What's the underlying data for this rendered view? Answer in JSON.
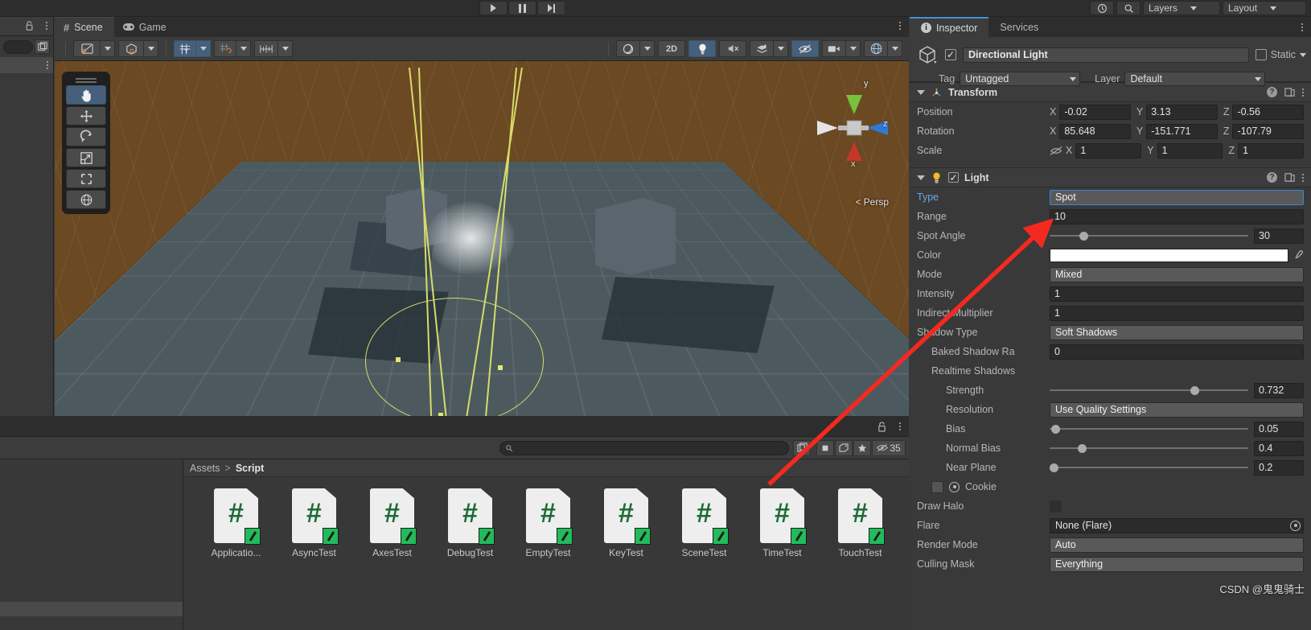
{
  "topbar": {
    "play": "play-icon",
    "pause": "pause-icon",
    "step": "step-icon",
    "collab_label": "collab-icon",
    "cloud_label": "cloud-icon",
    "account_label": "account-icon",
    "layers_label": "Layers",
    "layout_label": "Layout"
  },
  "scene_panel": {
    "tabs": [
      {
        "label": "Scene",
        "icon": "grid-icon",
        "active": true
      },
      {
        "label": "Game",
        "icon": "gamepad-icon",
        "active": false
      }
    ],
    "toolbar": {
      "draw_mode": "shaded-draw-mode-icon",
      "gizmo_mode": "render-mode-icon",
      "lighting_2d3d": "2D",
      "light_toggle": "lightbulb-icon",
      "audio_toggle": "mute-audio-icon",
      "fx_toggle": "effects-icon",
      "hidden_toggle": "hidden-objects-icon",
      "camera_toggle": "scene-camera-icon",
      "gizmos_toggle": "gizmos-icon",
      "grid_visibility": "grid-visibility-icon",
      "grid_snap": "grid-snap-icon",
      "snap_increment": "snap-increment-icon"
    },
    "tools": [
      {
        "name": "hand-tool",
        "active": true
      },
      {
        "name": "move-tool",
        "active": false
      },
      {
        "name": "rotate-tool",
        "active": false
      },
      {
        "name": "scale-tool",
        "active": false
      },
      {
        "name": "rect-tool",
        "active": false
      },
      {
        "name": "transform-tool",
        "active": false
      }
    ],
    "gizmo": {
      "axis_y": "y",
      "axis_x": "x",
      "axis_z": "z",
      "projection": "Persp"
    }
  },
  "project_panel": {
    "search_placeholder": "",
    "search_value": "",
    "breadcrumb": {
      "root": "Assets",
      "separator": ">",
      "current": "Script"
    },
    "assets": [
      {
        "name": "Applicatio...",
        "type": "csharp-script"
      },
      {
        "name": "AsyncTest",
        "type": "csharp-script"
      },
      {
        "name": "AxesTest",
        "type": "csharp-script"
      },
      {
        "name": "DebugTest",
        "type": "csharp-script"
      },
      {
        "name": "EmptyTest",
        "type": "csharp-script"
      },
      {
        "name": "KeyTest",
        "type": "csharp-script"
      },
      {
        "name": "SceneTest",
        "type": "csharp-script"
      },
      {
        "name": "TimeTest",
        "type": "csharp-script"
      },
      {
        "name": "TouchTest",
        "type": "csharp-script"
      }
    ],
    "hidden_count": "35"
  },
  "inspector": {
    "tabs": [
      {
        "label": "Inspector",
        "active": true
      },
      {
        "label": "Services",
        "active": false
      }
    ],
    "object": {
      "enabled": true,
      "name": "Directional Light",
      "static_label": "Static",
      "static_checked": false,
      "tag_label": "Tag",
      "tag_value": "Untagged",
      "layer_label": "Layer",
      "layer_value": "Default"
    },
    "transform": {
      "title": "Transform",
      "position_label": "Position",
      "rotation_label": "Rotation",
      "scale_label": "Scale",
      "axis_x": "X",
      "axis_y": "Y",
      "axis_z": "Z",
      "position": {
        "x": "-0.02",
        "y": "3.13",
        "z": "-0.56"
      },
      "rotation": {
        "x": "85.648",
        "y": "-151.771",
        "z": "-107.79"
      },
      "scale": {
        "x": "1",
        "y": "1",
        "z": "1"
      }
    },
    "light": {
      "title": "Light",
      "enabled": true,
      "type_label": "Type",
      "type_value": "Spot",
      "range_label": "Range",
      "range_value": "10",
      "spot_angle_label": "Spot Angle",
      "spot_angle_value": "30",
      "spot_angle_pct": 17,
      "color_label": "Color",
      "color_value": "#ffffff",
      "mode_label": "Mode",
      "mode_value": "Mixed",
      "intensity_label": "Intensity",
      "intensity_value": "1",
      "indirect_label": "Indirect Multiplier",
      "indirect_value": "1",
      "shadow_type_label": "Shadow Type",
      "shadow_type_value": "Soft Shadows",
      "baked_shadow_label": "Baked Shadow Ra",
      "baked_shadow_value": "0",
      "realtime_shadows_label": "Realtime Shadows",
      "strength_label": "Strength",
      "strength_value": "0.732",
      "strength_pct": 73,
      "resolution_label": "Resolution",
      "resolution_value": "Use Quality Settings",
      "bias_label": "Bias",
      "bias_value": "0.05",
      "bias_pct": 3,
      "normal_bias_label": "Normal Bias",
      "normal_bias_value": "0.4",
      "normal_bias_pct": 16,
      "near_plane_label": "Near Plane",
      "near_plane_value": "0.2",
      "near_plane_pct": 2,
      "cookie_label": "Cookie",
      "draw_halo_label": "Draw Halo",
      "draw_halo_checked": false,
      "flare_label": "Flare",
      "flare_value": "None (Flare)",
      "render_mode_label": "Render Mode",
      "render_mode_value": "Auto",
      "culling_mask_label": "Culling Mask",
      "culling_mask_value": "Everything"
    }
  },
  "annotation": {
    "arrow_color": "#f4291f",
    "watermark": "CSDN @鬼鬼骑士"
  }
}
